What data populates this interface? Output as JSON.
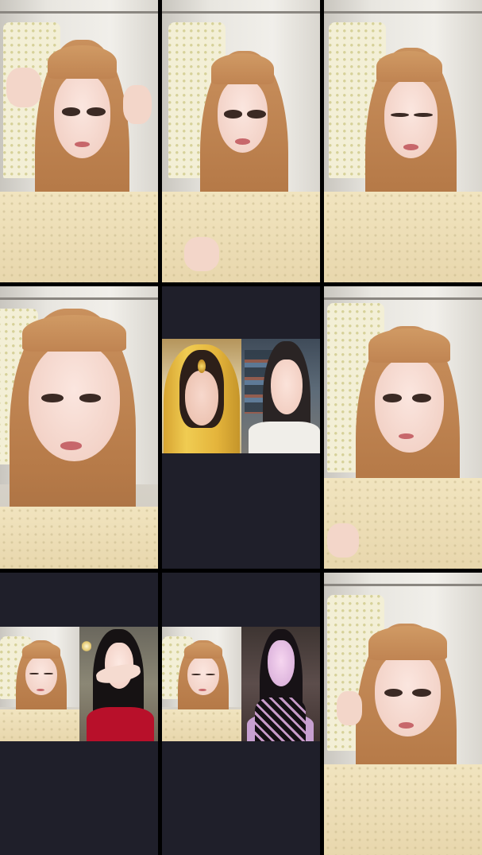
{
  "layout": {
    "grid": "3x3",
    "background_color": "#000000",
    "empty_panel_color": "#1f1f2a"
  },
  "tiles": [
    {
      "id": 1,
      "kind": "single-camera",
      "subject": "host",
      "pose": "hands-in-hair"
    },
    {
      "id": 2,
      "kind": "single-camera",
      "subject": "host",
      "pose": "touching-hair"
    },
    {
      "id": 3,
      "kind": "single-camera",
      "subject": "host",
      "pose": "looking-down"
    },
    {
      "id": 4,
      "kind": "single-camera",
      "subject": "host",
      "pose": "close-up"
    },
    {
      "id": 5,
      "kind": "duet",
      "guests": [
        "guest-traditional-outfit",
        "guest-home-room"
      ]
    },
    {
      "id": 6,
      "kind": "single-camera",
      "subject": "host",
      "pose": "front"
    },
    {
      "id": 7,
      "kind": "duet",
      "guests": [
        "host",
        "guest-red-top"
      ]
    },
    {
      "id": 8,
      "kind": "duet",
      "guests": [
        "host",
        "guest-dark-room"
      ]
    },
    {
      "id": 9,
      "kind": "single-camera",
      "subject": "host",
      "pose": "hand-near-ear"
    }
  ],
  "colors": {
    "hair": "#c08452",
    "skin": "#f3d3c8",
    "cardigan": "#ecdcb2",
    "robe": "#f3efd6",
    "gold_veil": "#e4b43b",
    "red_top": "#b8102a"
  }
}
